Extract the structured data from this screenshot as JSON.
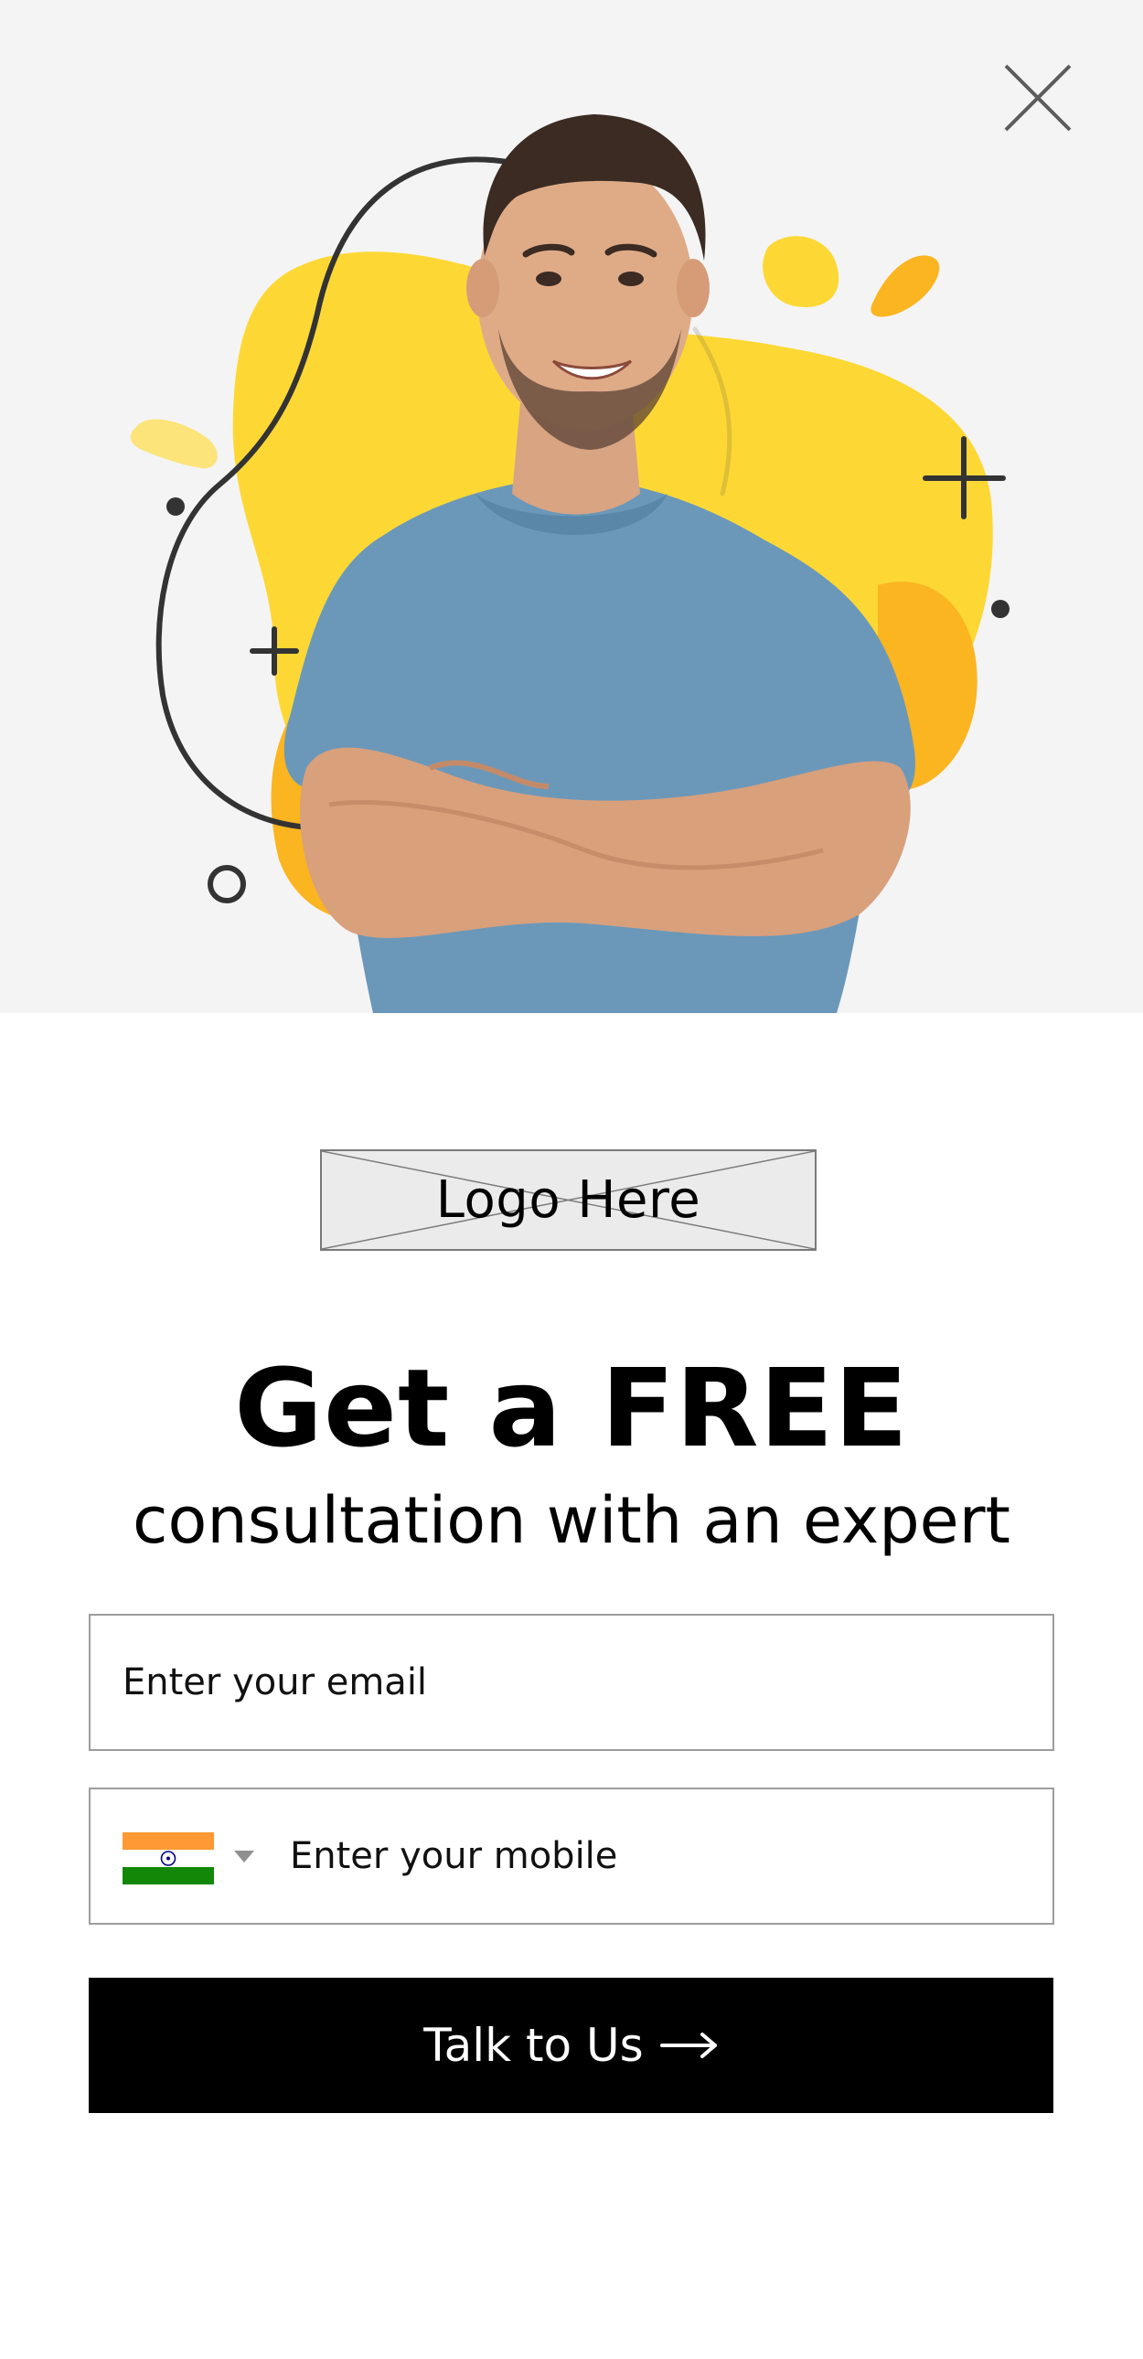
{
  "hero": {
    "photo_icon": "smiling-man-photo",
    "accent_colors": {
      "yellow": "#fdd835",
      "amber": "#fbb520",
      "light_yellow": "#fde47a",
      "background": "#f4f4f4"
    }
  },
  "close": {
    "icon": "close-icon"
  },
  "logo": {
    "text": "Logo Here",
    "icon": "image-placeholder-icon"
  },
  "headline": {
    "title": "Get a FREE",
    "subtitle": "consultation with an expert"
  },
  "form": {
    "email_placeholder": "Enter your email",
    "email_value": "",
    "mobile_placeholder": "Enter your mobile",
    "mobile_value": "",
    "country_flag_icon": "india-flag-icon",
    "country_dropdown_icon": "caret-down-icon"
  },
  "cta": {
    "label": "Talk to Us",
    "icon": "arrow-right-icon",
    "background": "#000000",
    "text_color": "#ffffff"
  }
}
